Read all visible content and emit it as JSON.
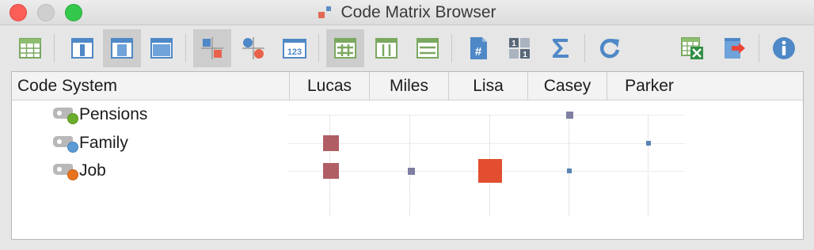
{
  "window": {
    "title": "Code Matrix Browser"
  },
  "toolbar": {
    "buttons": [
      {
        "name": "table-view-icon",
        "active": false
      },
      {
        "name": "column-layout-1-icon",
        "active": false
      },
      {
        "name": "column-layout-2-icon",
        "active": true
      },
      {
        "name": "column-layout-3-icon",
        "active": false
      },
      {
        "name": "squares-symbol-icon",
        "active": true
      },
      {
        "name": "circles-symbol-icon",
        "active": false
      },
      {
        "name": "numbers-icon",
        "active": false
      },
      {
        "name": "grid-hash-icon",
        "active": true
      },
      {
        "name": "columns-icon",
        "active": false
      },
      {
        "name": "rows-icon",
        "active": false
      },
      {
        "name": "document-hash-icon",
        "active": false
      },
      {
        "name": "binary-matrix-icon",
        "active": false
      },
      {
        "name": "sigma-icon",
        "active": false
      },
      {
        "name": "refresh-icon",
        "active": false
      },
      {
        "name": "export-excel-icon",
        "active": false
      },
      {
        "name": "export-arrow-icon",
        "active": false
      },
      {
        "name": "info-icon",
        "active": false
      }
    ]
  },
  "matrix": {
    "header": {
      "code_system_label": "Code System",
      "columns": [
        "Lucas",
        "Miles",
        "Lisa",
        "Casey",
        "Parker"
      ]
    },
    "rows": [
      {
        "label": "Pensions",
        "dot_color": "#6aae2a",
        "cells": [
          0,
          0,
          0,
          1,
          0
        ]
      },
      {
        "label": "Family",
        "dot_color": "#5b9bd5",
        "cells": [
          3,
          0,
          0,
          0,
          1
        ]
      },
      {
        "label": "Job",
        "dot_color": "#e8731e",
        "cells": [
          3,
          1,
          4,
          1,
          0
        ]
      }
    ],
    "symbol_colors": {
      "1": "#7e7fa2",
      "3": "#b05e64",
      "4": "#e24e2f",
      "small": "#5982b3"
    }
  }
}
